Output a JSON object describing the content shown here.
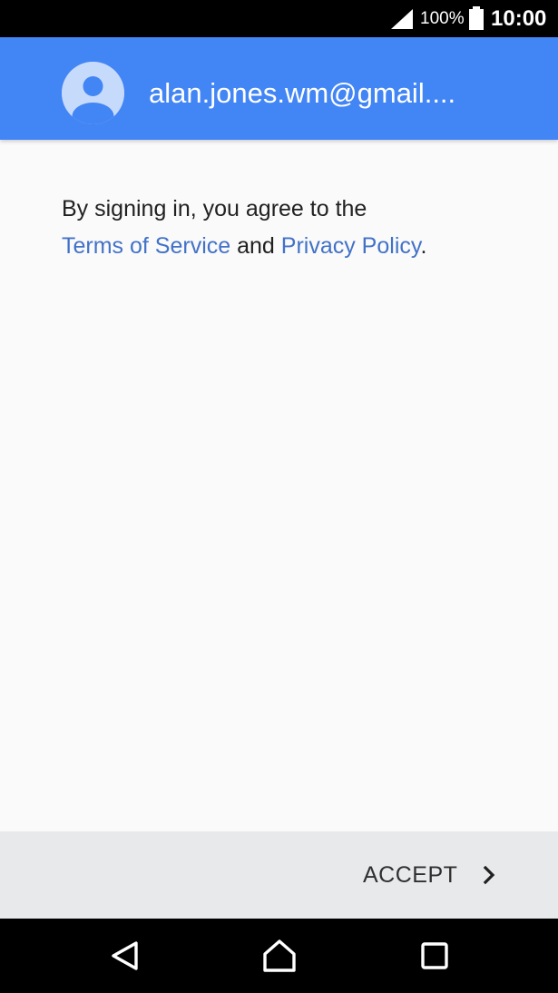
{
  "status_bar": {
    "battery_percent": "100%",
    "time": "10:00",
    "icons": [
      "signal-icon",
      "battery-icon"
    ]
  },
  "header": {
    "account_email": "alan.jones.wm@gmail....",
    "avatar_icon": "account-avatar-icon",
    "background_color": "#4285f4"
  },
  "content": {
    "text_before": "By signing in, you agree to the",
    "terms_link": "Terms of Service",
    "and_text": " and ",
    "privacy_link": "Privacy Policy",
    "period": ".",
    "link_color": "#4272c8"
  },
  "action_bar": {
    "accept_label": "ACCEPT",
    "accept_icon": "chevron-right-icon"
  },
  "nav_bar": {
    "icons": [
      "back-icon",
      "home-icon",
      "recents-icon"
    ]
  }
}
